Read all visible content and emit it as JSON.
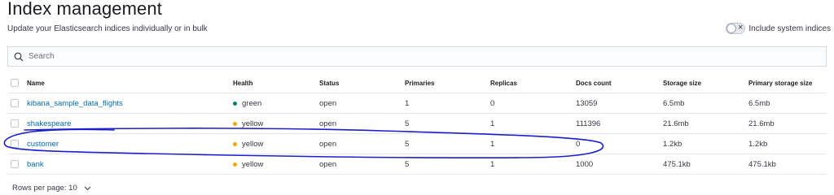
{
  "header": {
    "title": "Index management",
    "subtitle": "Update your Elasticsearch indices individually or in bulk",
    "toggle_label": "Include system indices"
  },
  "search": {
    "placeholder": "Search"
  },
  "table": {
    "columns": [
      "Name",
      "Health",
      "Status",
      "Primaries",
      "Replicas",
      "Docs count",
      "Storage size",
      "Primary storage size"
    ],
    "rows": [
      {
        "name": "kibana_sample_data_flights",
        "health": "green",
        "status": "open",
        "primaries": "1",
        "replicas": "0",
        "docs": "13059",
        "storage": "6.5mb",
        "pstorage": "6.5mb"
      },
      {
        "name": "shakespeare",
        "health": "yellow",
        "status": "open",
        "primaries": "5",
        "replicas": "1",
        "docs": "111396",
        "storage": "21.6mb",
        "pstorage": "21.6mb"
      },
      {
        "name": "customer",
        "health": "yellow",
        "status": "open",
        "primaries": "5",
        "replicas": "1",
        "docs": "0",
        "storage": "1.2kb",
        "pstorage": "1.2kb"
      },
      {
        "name": "bank",
        "health": "yellow",
        "status": "open",
        "primaries": "5",
        "replicas": "1",
        "docs": "1000",
        "storage": "475.1kb",
        "pstorage": "475.1kb"
      }
    ]
  },
  "footer": {
    "rows_per_page": "Rows per page: 10"
  },
  "colors": {
    "green": "#017d73",
    "yellow": "#f5a700",
    "link": "#006bb8",
    "annotation": "#1a1fc9"
  },
  "icons": {
    "search": "magnifier-icon",
    "toggle_off": "cross-icon",
    "pagination": "chevron-down-icon"
  }
}
